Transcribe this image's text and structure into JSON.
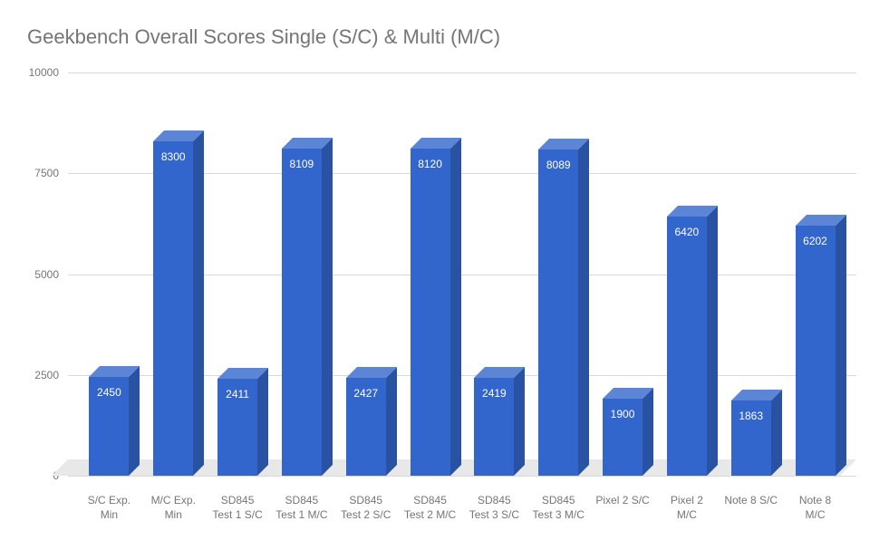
{
  "chart_data": {
    "type": "bar",
    "title": "Geekbench Overall Scores Single (S/C) & Multi (M/C)",
    "xlabel": "",
    "ylabel": "",
    "ylim": [
      0,
      10000
    ],
    "yticks": [
      0,
      2500,
      5000,
      7500,
      10000
    ],
    "categories": [
      "S/C Exp. Min",
      "M/C Exp. Min",
      "SD845 Test 1 S/C",
      "SD845 Test 1 M/C",
      "SD845 Test 2 S/C",
      "SD845 Test 2 M/C",
      "SD845 Test 3 S/C",
      "SD845 Test 3 M/C",
      "Pixel 2 S/C",
      "Pixel 2 M/C",
      "Note 8 S/C",
      "Note 8 M/C"
    ],
    "values": [
      2450,
      8300,
      2411,
      8109,
      2427,
      8120,
      2419,
      8089,
      1900,
      6420,
      1863,
      6202
    ],
    "bar_color": "#3366cc"
  }
}
